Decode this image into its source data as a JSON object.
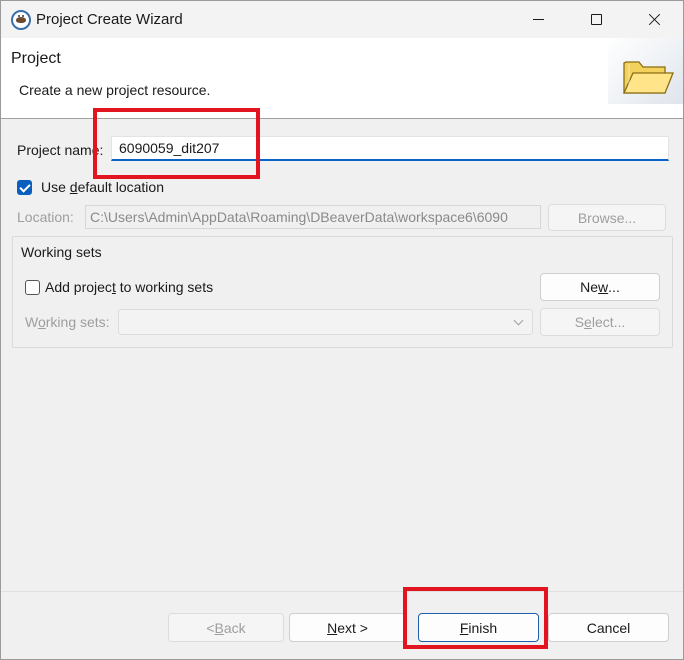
{
  "window": {
    "title": "Project Create Wizard",
    "icon": "dbeaver-app-icon"
  },
  "banner": {
    "title": "Project",
    "description": "Create a new project resource.",
    "icon": "folder-icon"
  },
  "form": {
    "project_name_label_prefix": "Project name",
    "project_name_label_suffix": ":",
    "project_name_value": "6090059_dit207",
    "use_default_location": {
      "label_prefix": "Use ",
      "label_mnemonic": "d",
      "label_suffix": "efault location",
      "checked": true
    },
    "location_label": "Location:",
    "location_value": "C:\\Users\\Admin\\AppData\\Roaming\\DBeaverData\\workspace6\\6090",
    "browse_label_prefix": "Browse",
    "browse_label_suffix": "..."
  },
  "working_sets": {
    "group_label": "Working sets",
    "add_checkbox": {
      "label_prefix": "Add projec",
      "label_mnemonic": "t",
      "label_suffix": " to working sets",
      "checked": false
    },
    "new_label_prefix": "Ne",
    "new_label_mnemonic": "w",
    "new_label_suffix": "...",
    "sets_label_prefix": "W",
    "sets_label_mnemonic": "o",
    "sets_label_suffix": "rking sets:",
    "select_label_prefix": "S",
    "select_label_mnemonic": "e",
    "select_label_suffix": "lect..."
  },
  "footer": {
    "back_prefix": "< ",
    "back_mnemonic": "B",
    "back_suffix": "ack",
    "next_mnemonic": "N",
    "next_suffix": "ext >",
    "finish_mnemonic": "F",
    "finish_suffix": "inish",
    "cancel_label": "Cancel"
  },
  "colors": {
    "accent": "#0a5ebe",
    "annotation": "#e2141f"
  }
}
